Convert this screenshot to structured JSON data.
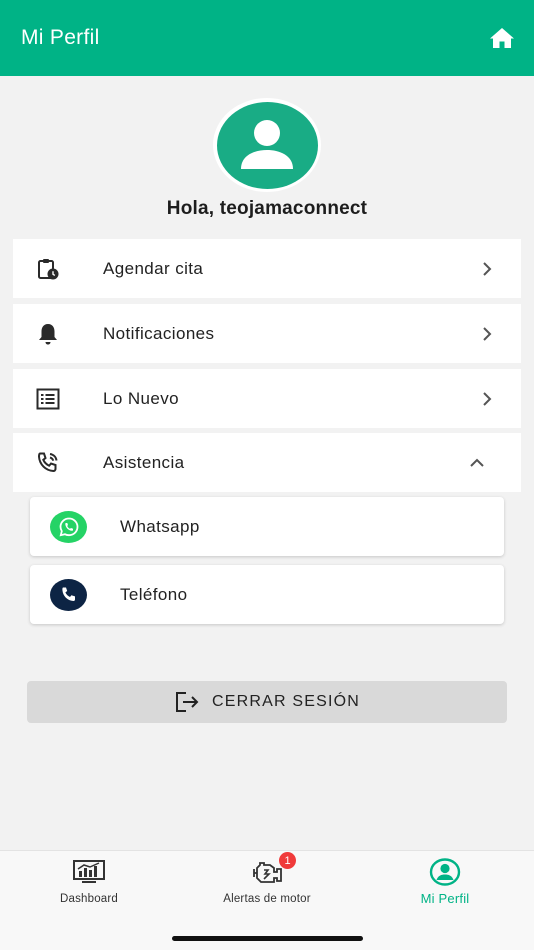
{
  "header": {
    "title": "Mi Perfil"
  },
  "profile": {
    "greeting": "Hola, teojamaconnect"
  },
  "menu": {
    "items": [
      {
        "label": "Agendar cita"
      },
      {
        "label": "Notificaciones"
      },
      {
        "label": "Lo Nuevo"
      },
      {
        "label": "Asistencia"
      }
    ],
    "assistance": [
      {
        "label": "Whatsapp"
      },
      {
        "label": "Teléfono"
      }
    ]
  },
  "logout": {
    "label": "CERRAR SESIÓN"
  },
  "tabbar": {
    "tabs": [
      {
        "label": "Dashboard"
      },
      {
        "label": "Alertas de motor",
        "badge": "1"
      },
      {
        "label": "Mi Perfil"
      }
    ]
  },
  "colors": {
    "primary": "#00b386",
    "whatsapp": "#25d366",
    "phone": "#0d2444",
    "badge": "#f03a3a"
  }
}
